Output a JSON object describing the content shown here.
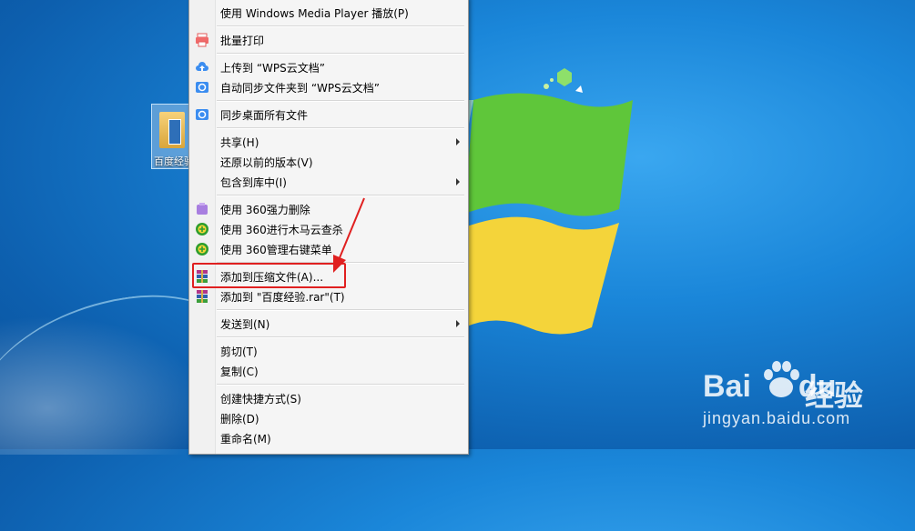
{
  "desktop": {
    "icon_label": "百度经验"
  },
  "menu": {
    "items": [
      {
        "label": "使用 Windows Media Player 播放(P)",
        "icon": "none"
      },
      {
        "label": "批量打印",
        "icon": "printer-icon"
      },
      {
        "label": "上传到 “WPS云文档”",
        "icon": "cloud-upload-icon"
      },
      {
        "label": "自动同步文件夹到 “WPS云文档”",
        "icon": "sync-folder-icon"
      },
      {
        "label": "同步桌面所有文件",
        "icon": "sync-desktop-icon"
      },
      {
        "label": "共享(H)",
        "icon": "none",
        "submenu": true
      },
      {
        "label": "还原以前的版本(V)",
        "icon": "none"
      },
      {
        "label": "包含到库中(I)",
        "icon": "none",
        "submenu": true
      },
      {
        "label": "使用 360强力删除",
        "icon": "360-delete-icon"
      },
      {
        "label": "使用 360进行木马云查杀",
        "icon": "360-scan-icon"
      },
      {
        "label": "使用 360管理右键菜单",
        "icon": "360-menu-icon"
      },
      {
        "label": "添加到压缩文件(A)...",
        "icon": "winrar-icon",
        "highlighted": true
      },
      {
        "label": "添加到 \"百度经验.rar\"(T)",
        "icon": "winrar-icon"
      },
      {
        "label": "发送到(N)",
        "icon": "none",
        "submenu": true
      },
      {
        "label": "剪切(T)",
        "icon": "none"
      },
      {
        "label": "复制(C)",
        "icon": "none"
      },
      {
        "label": "创建快捷方式(S)",
        "icon": "none"
      },
      {
        "label": "删除(D)",
        "icon": "none"
      },
      {
        "label": "重命名(M)",
        "icon": "none"
      }
    ]
  },
  "watermark": {
    "brand_latin": "Bai",
    "brand_latin_suffix": "du",
    "brand_cn": "经验",
    "url": "jingyan.baidu.com"
  },
  "colors": {
    "highlight_box": "#e02020",
    "annotation_arrow": "#e02020",
    "desktop_blue": "#1a86d9"
  }
}
